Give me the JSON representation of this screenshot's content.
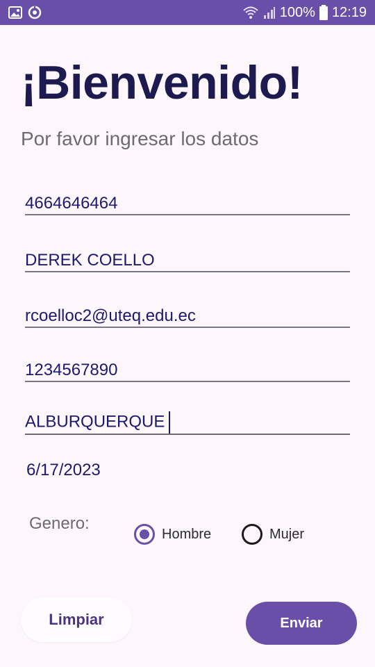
{
  "status_bar": {
    "battery": "100%",
    "time": "12:19",
    "icons": [
      "image-icon",
      "sync-icon",
      "wifi-icon",
      "signal-icon",
      "battery-icon"
    ]
  },
  "header": {
    "title": "¡Bienvenido!",
    "subtitle": "Por favor ingresar los datos"
  },
  "form": {
    "field1": "4664646464",
    "field2": "DEREK COELLO",
    "field3": "rcoelloc2@uteq.edu.ec",
    "field4": "1234567890",
    "field5": "ALBURQUERQUE",
    "date": "6/17/2023",
    "gender_label": "Genero:",
    "gender_options": [
      "Hombre",
      "Mujer"
    ],
    "gender_selected": "Hombre"
  },
  "actions": {
    "clear_label": "Limpiar",
    "send_label": "Enviar"
  },
  "colors": {
    "accent": "#6a4fa8",
    "title": "#1c1a4e",
    "field_text": "#1c1a6e",
    "background": "#fdf7fc"
  }
}
